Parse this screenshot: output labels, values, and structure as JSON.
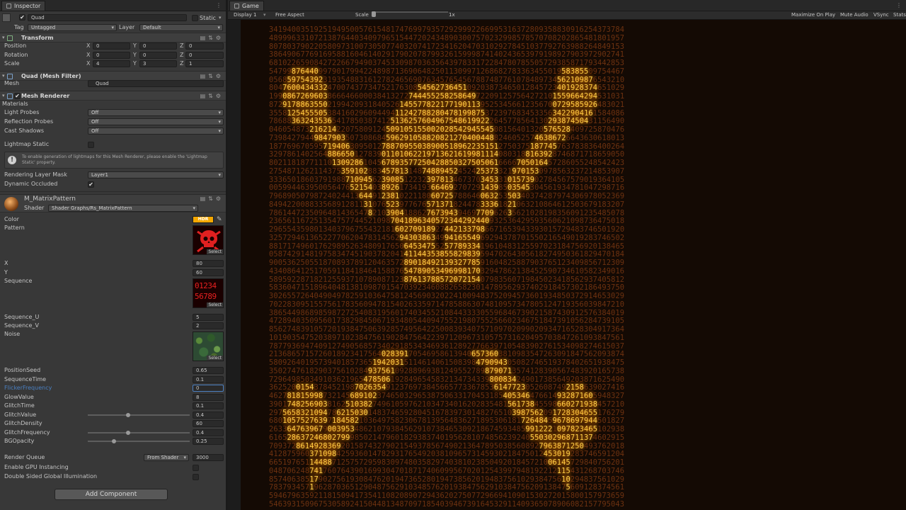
{
  "inspector": {
    "tab_title": "Inspector",
    "object": {
      "active": "✔",
      "name": "Quad",
      "static_label": "Static",
      "tag_label": "Tag",
      "tag_value": "Untagged",
      "layer_label": "Layer",
      "layer_value": "Default"
    },
    "transform": {
      "title": "Transform",
      "position_label": "Position",
      "rotation_label": "Rotation",
      "scale_label": "Scale",
      "axis_x": "X",
      "axis_y": "Y",
      "axis_z": "Z",
      "position": [
        "0",
        "0",
        "0"
      ],
      "rotation": [
        "0",
        "0",
        "0"
      ],
      "scale": [
        "4",
        "3",
        "1"
      ]
    },
    "mesh_filter": {
      "title": "Quad (Mesh Filter)",
      "mesh_label": "Mesh",
      "mesh_value": "Quad"
    },
    "mesh_renderer": {
      "title": "Mesh Renderer",
      "materials_label": "Materials",
      "light_probes_label": "Light Probes",
      "light_probes_value": "Off",
      "reflection_probes_label": "Reflection Probes",
      "reflection_probes_value": "Off",
      "cast_shadows_label": "Cast Shadows",
      "cast_shadows_value": "Off",
      "lightmap_static_label": "Lightmap Static",
      "help_text": "To enable generation of lightmaps for this Mesh Renderer, please enable the 'Lightmap Static' property.",
      "rendering_layer_mask_label": "Rendering Layer Mask",
      "rendering_layer_mask_value": "Layer1",
      "dynamic_occluded_label": "Dynamic Occluded",
      "dynamic_occluded_check": "✔"
    },
    "material": {
      "name": "M_MatrixPattern",
      "shader_label": "Shader",
      "shader_value": "Shader Graphs/Rs_MatrixPattern",
      "color_label": "Color",
      "hdr_label": "HDR",
      "pattern_label": "Pattern",
      "select_label": "Select",
      "x_label": "X",
      "x_value": "80",
      "y_label": "Y",
      "y_value": "60",
      "sequence_label": "Sequence",
      "sequence_digits_top": "01234",
      "sequence_digits_bottom": "56789",
      "sequence_u_label": "Sequence_U",
      "sequence_u_value": "5",
      "sequence_v_label": "Sequence_V",
      "sequence_v_value": "2",
      "noise_label": "Noise",
      "position_seed_label": "PositionSeed",
      "position_seed_value": "0.65",
      "sequence_time_label": "SequenceTime",
      "sequence_time_value": "0.1",
      "flicker_frequency_label": "FlickerFrequency",
      "flicker_frequency_value": "0",
      "glow_value_label": "GlowValue",
      "glow_value_value": "8",
      "glitch_time_label": "GlitchTime",
      "glitch_time_value": "0.1",
      "glitch_value_label": "GlitchValue",
      "glitch_value_value": "0.4",
      "glitch_density_label": "GlitchDensity",
      "glitch_density_value": "60",
      "glitch_frequency_label": "GlitchFrequency",
      "glitch_frequency_value": "0.4",
      "bg_opacity_label": "BGOpacity",
      "bg_opacity_value": "0.25",
      "render_queue_label": "Render Queue",
      "render_queue_source": "From Shader",
      "render_queue_value": "3000",
      "gpu_instancing_label": "Enable GPU Instancing",
      "double_sided_gi_label": "Double Sided Global Illumination"
    },
    "add_component_label": "Add Component",
    "colors": {
      "panel_bg": "#383838",
      "accent_blue": "#4a7fc1",
      "hdr_color": "#f5a800"
    }
  },
  "game": {
    "tab_title": "Game",
    "display_label": "Display 1",
    "aspect_label": "Free Aspect",
    "scale_label": "Scale",
    "scale_value": "1x",
    "maximize_label": "Maximize On Play",
    "mute_label": "Mute Audio",
    "vsync_label": "VSync",
    "stats_label": "Stats",
    "matrix_lines": [
      "3419400351925194950057615481747699793572929992266995316372809358830916254373784",
      "4899963310721387644034097965154472024348903007570232998578570708202865481801957",
      "8078037902205809731007305077403207417234162047031029278451037792763988264849153",
      "3864906776916958816046140291790207879932615999874140243653979198927903972902741",
      "6810226590842722667949037453309870363564397833172284780785505729385871793442853",
      "5479987644099790179942248987136906482501130997126868278336345501958385509754467",
      "0568597543923193548831612782465690763457654567887487761078489734562109876543210",
      "8047600434332470074377347521763085456273645109203873465012845723401928374651029",
      "1990867269603866646600038413272744455258258649722091257564272101559664294531031",
      "8729178863550219942093184052614557782217719011395253456612356700729585926483021",
      "3558125455505384160296094494112427882804781998753723976834533563422904161584086",
      "7868836324353654178503874125136257604967548619922264577856413029387450431156490",
      "0460548732162142207580912450910515500202854294554508156401320576528409725870476",
      "7398427944984790350730868459629105882082127040044882460525746386726643630618013",
      "1877696705957194063095012788709550389005189622351512750375187745763783836400264",
      "3297861402564886650127839011010622197136216199811140803188163928746871718659050",
      "8021181877111013092861045678935772504288503275050616666705016457286055248542423",
      "2754871262114375359102883457813148748894524524253733219701530978563237214853907",
      "3336501860379198871094562390851223239781346737034533101573902784567579019364105",
      "0059944639500564765215403892617341936646927072914398503545304561934781047298716",
      "7968905079872402441364491238102211806072578864606325350340374287974306978052369",
      "8494220088335689128113107652397767657137182447833361821063210864612503679183207",
      "7861447235096481436547821039041886276739439469770962635621028198356091235485078",
      "2365611672513547577445210987041896340572344292440932536429593560621098736475018",
      "2965543598013403796755432181602709189274421337986671653943393015729483746501920",
      "3257294613652277062047831456294303863499416554969294378701550216549019283746502",
      "8817174960176298952634809176506453475525778933419610483125597023184756920138465",
      "0587429148197583474519037820414114435385582983959470264305618274950361829470184",
      "9005362505518708937891204635728901849213932778591604825887903765123409856712309",
      "4340864125170591184184641588765478905349699817032947862138452590734610582349016",
      "5895922871821255937107890871238761378857207215407983560719845023418562937405812",
      "5836047151896404813810987015470392346088265823014789562937402918457302186493750",
      "3026557264049049782591036475812456903202241009483752094573601934850372914653029",
      "7022830951557561783560947815402633597147858863074810957347805124719356039847210",
      "3865449868985987272540831956017403455210844333305596846739021587430912576384019",
      "4728940350956017382984506719348054409475521980755256602346751847391056284739105",
      "8562748391057201938475063928574956422500839340757109702099020934716528304917364",
      "1019035475203897102384756190284756422397120967310575731620495703847261093847561",
      "7877936947409127490568573402918534346936128927766397105483902761534098274615037",
      "2136865715726018923417564028391705469586139406573603810983547263091847562093874",
      "5809264019573940185736519420315114614061508398479094305082746519378402651938475",
      "3502747618290375610284937561092889693812495527898790713574128390567483920165738",
      "7296498503491036219654785061928496545832134734339800834249017385649203871625490",
      "3625200154378452198702635491237697384566577336785361477230526087492158639027416",
      "4627818159987321456891023746503296538750633170453185405346476614932871605948327",
      "3901748256903816251038274961059762103473401620283548156173845598660271938457210",
      "2975658321094786215030148374659280451678397301482765103987562091728304655176279",
      "6801057527639718458210364975823067813956483627189530618172648459678697944501827",
      "2633647639679003953486210793845629107384653092186745934859912221097823465102938",
      "6165286372468027999850214796018293837401956281074856239240550302968711374602915",
      "7093728614928369201587432790215493785674902136478950385608927963871250493762018",
      "4128759603710984259360147829317654920381096573145930218475012453019283746591204",
      "6651976511448871257572959830974803582974038102385049201845721006145729840756201",
      "0487062487417607643901699304701871740609956702012543997948192212115431268703746",
      "8574063851790275619308476201947365280194738562019483756102938475610294837561029",
      "7837934571962870365129048756291034857620193847562910384756209138475609128374561",
      "5946796359211815094173541108208907294362027507729669410901530272015800157973659",
      "5463931509675305892415044813487097185403946739164532911409365078906082157795043"
    ]
  }
}
